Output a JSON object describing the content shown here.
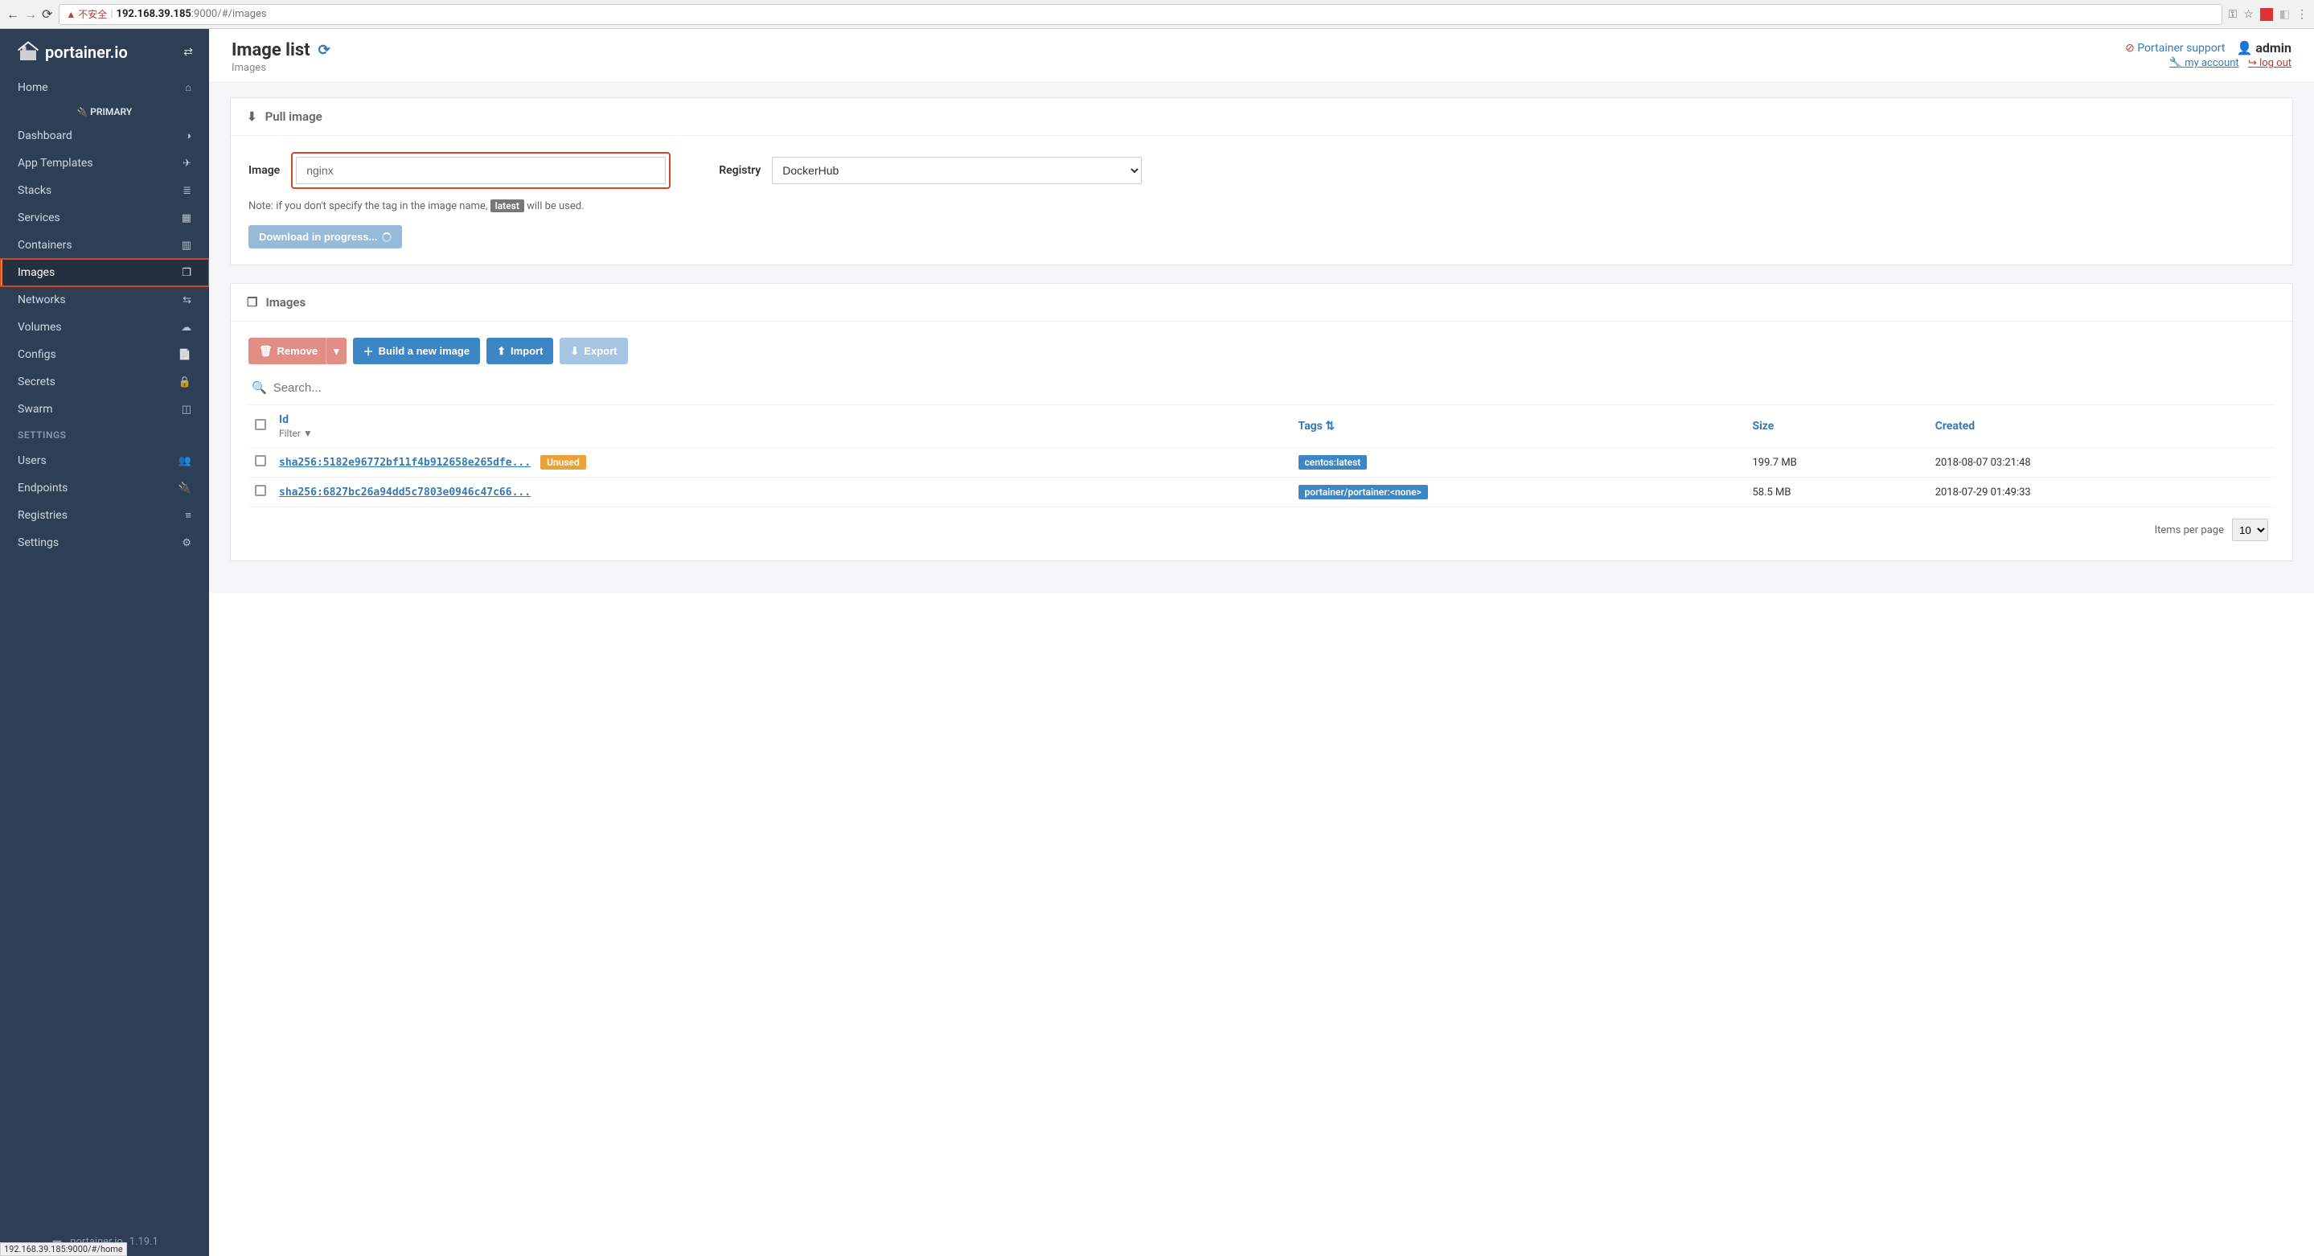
{
  "browser": {
    "url_insecure_label": "不安全",
    "url_host": "192.168.39.185",
    "url_rest": ":9000/#/images"
  },
  "brand": "portainer.io",
  "sidebar": {
    "home": "Home",
    "endpoint_label": "PRIMARY",
    "items": [
      {
        "label": "Dashboard",
        "icon": "◑"
      },
      {
        "label": "App Templates",
        "icon": "✈"
      },
      {
        "label": "Stacks",
        "icon": "≣"
      },
      {
        "label": "Services",
        "icon": "▦"
      },
      {
        "label": "Containers",
        "icon": "▥"
      },
      {
        "label": "Images",
        "icon": "❐"
      },
      {
        "label": "Networks",
        "icon": "⇆"
      },
      {
        "label": "Volumes",
        "icon": "☁"
      },
      {
        "label": "Configs",
        "icon": "📄"
      },
      {
        "label": "Secrets",
        "icon": "🔒"
      },
      {
        "label": "Swarm",
        "icon": "◫"
      }
    ],
    "settings_heading": "SETTINGS",
    "settings": [
      {
        "label": "Users",
        "icon": "👥"
      },
      {
        "label": "Endpoints",
        "icon": "🔌"
      },
      {
        "label": "Registries",
        "icon": "≡"
      },
      {
        "label": "Settings",
        "icon": "⚙"
      }
    ],
    "footer_brand": "portainer.io",
    "footer_version": "1.19.1"
  },
  "header": {
    "title": "Image list",
    "breadcrumb": "Images",
    "support_label": "Portainer support",
    "user": "admin",
    "my_account": "my account",
    "log_out": "log out"
  },
  "pull_panel": {
    "title": "Pull image",
    "image_label": "Image",
    "image_value": "nginx",
    "registry_label": "Registry",
    "registry_value": "DockerHub",
    "note_prefix": "Note: if you don't specify the tag in the image name, ",
    "note_tag": "latest",
    "note_suffix": " will be used.",
    "button_label": "Download in progress..."
  },
  "images_panel": {
    "title": "Images",
    "remove": "Remove",
    "build": "Build a new image",
    "import": "Import",
    "export": "Export",
    "search_placeholder": "Search...",
    "col_id": "Id",
    "col_id_sub": "Filter",
    "col_tags": "Tags",
    "col_size": "Size",
    "col_created": "Created",
    "rows": [
      {
        "id": "sha256:5182e96772bf11f4b912658e265dfe...",
        "unused": true,
        "unused_label": "Unused",
        "tags": [
          "centos:latest"
        ],
        "size": "199.7 MB",
        "created": "2018-08-07 03:21:48"
      },
      {
        "id": "sha256:6827bc26a94dd5c7803e0946c47c66...",
        "unused": false,
        "tags": [
          "portainer/portainer:<none>"
        ],
        "size": "58.5 MB",
        "created": "2018-07-29 01:49:33"
      }
    ],
    "items_per_page_label": "Items per page",
    "items_per_page": "10"
  },
  "status_bar": "192.168.39.185:9000/#/home"
}
